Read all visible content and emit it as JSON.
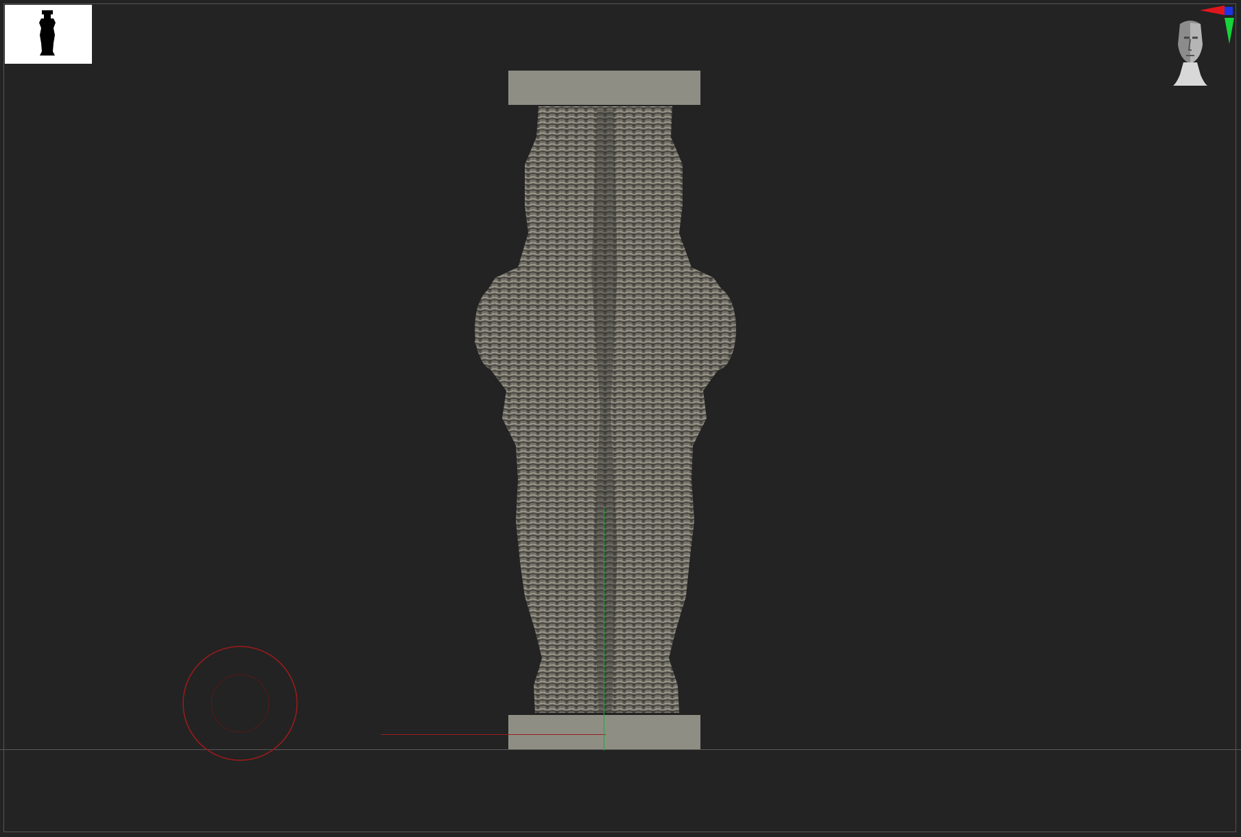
{
  "viewport": {
    "background": "#232323",
    "frame_color": "#555555"
  },
  "thumbnail": {
    "background": "#ffffff",
    "icon": "column-silhouette-icon"
  },
  "model": {
    "cap_color": "#8f8e84",
    "body_color": "#6f6c64",
    "highlight_color": "#b4b0a3"
  },
  "navigation": {
    "head_icon": "view-orientation-head-icon",
    "axis_colors": {
      "x": "#e0161d",
      "y": "#16d43a",
      "z": "#1b35e6"
    }
  },
  "brush": {
    "color": "#a01a1a"
  }
}
